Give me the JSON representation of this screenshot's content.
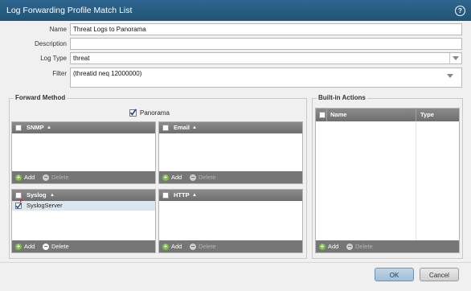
{
  "dialog": {
    "title": "Log Forwarding Profile Match List",
    "help_icon": "question-icon"
  },
  "form": {
    "name_label": "Name",
    "name_value": "Threat Logs to Panorama",
    "description_label": "Description",
    "description_value": "",
    "log_type_label": "Log Type",
    "log_type_value": "threat",
    "filter_label": "Filter",
    "filter_value": "(threatid neq 12000000)"
  },
  "forward_method": {
    "title": "Forward Method",
    "panorama_label": "Panorama",
    "panorama_checked": true,
    "snmp": {
      "header": "SNMP",
      "add": "Add",
      "delete": "Delete",
      "rows": []
    },
    "email": {
      "header": "Email",
      "add": "Add",
      "delete": "Delete",
      "rows": []
    },
    "syslog": {
      "header": "Syslog",
      "add": "Add",
      "delete": "Delete",
      "rows": [
        "SyslogServer"
      ]
    },
    "http": {
      "header": "HTTP",
      "add": "Add",
      "delete": "Delete",
      "rows": []
    }
  },
  "builtin_actions": {
    "title": "Built-in Actions",
    "col_name": "Name",
    "col_type": "Type",
    "add": "Add",
    "delete": "Delete"
  },
  "footer": {
    "ok": "OK",
    "cancel": "Cancel"
  }
}
